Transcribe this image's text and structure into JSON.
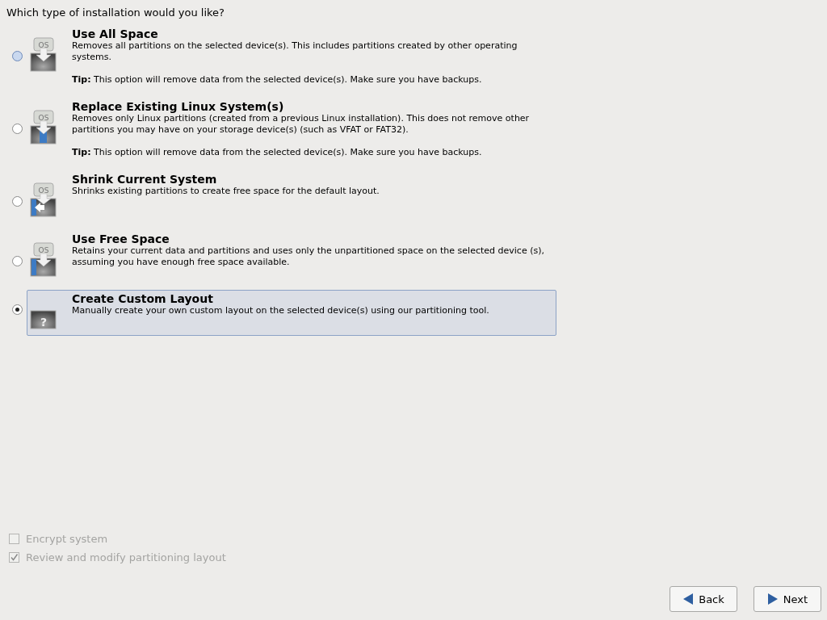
{
  "question": "Which type of installation would you like?",
  "options": [
    {
      "kind": "all",
      "icon_text": "OS",
      "title": "Use All Space",
      "description": "Removes all partitions on the selected device(s).  This includes partitions created by other operating systems.",
      "tip": "**Tip:** This option will remove data from the selected device(s).  Make sure you have backups.",
      "selected": false,
      "focused": true
    },
    {
      "kind": "replace",
      "icon_text": "OS",
      "title": "Replace Existing Linux System(s)",
      "description": "Removes only Linux partitions (created from a previous Linux installation).  This does not remove other partitions you may have on your storage device(s) (such as VFAT or FAT32).",
      "tip": "**Tip:** This option will remove data from the selected device(s).  Make sure you have backups.",
      "selected": false,
      "focused": false
    },
    {
      "kind": "shrink",
      "icon_text": "OS",
      "title": "Shrink Current System",
      "description": "Shrinks existing partitions to create free space for the default layout.",
      "selected": false,
      "focused": false
    },
    {
      "kind": "free",
      "icon_text": "OS",
      "title": "Use Free Space",
      "description": "Retains your current data and partitions and uses only the unpartitioned space on the selected device (s), assuming you have enough free space available.",
      "selected": false,
      "focused": false
    },
    {
      "kind": "custom",
      "icon_text": "?",
      "title": "Create Custom Layout",
      "description": "Manually create your own custom layout on the selected device(s) using our partitioning tool.",
      "selected": true,
      "focused": false
    }
  ],
  "checkboxes": [
    {
      "label": "Encrypt system",
      "checked": false,
      "disabled": true
    },
    {
      "label": "Review and modify partitioning layout",
      "checked": true,
      "disabled": true
    }
  ],
  "buttons": [
    {
      "kind": "back",
      "label": "Back"
    },
    {
      "kind": "next",
      "label": "Next"
    }
  ]
}
